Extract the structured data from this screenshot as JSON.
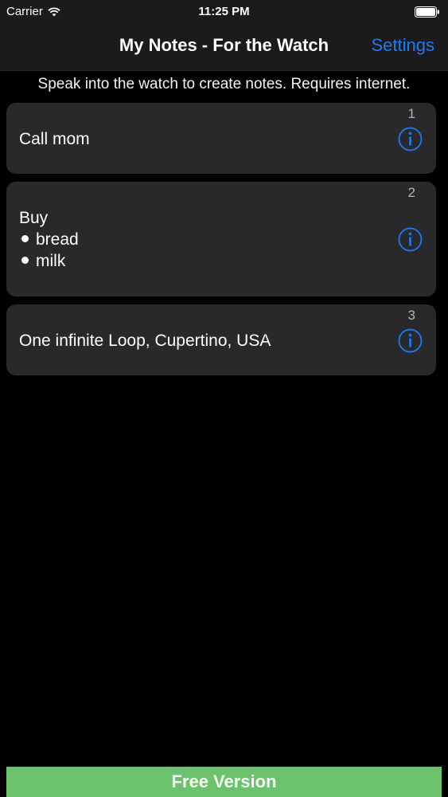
{
  "status_bar": {
    "carrier": "Carrier",
    "time": "11:25 PM"
  },
  "nav": {
    "title": "My Notes - For the Watch",
    "settings_label": "Settings"
  },
  "subtitle": "Speak into the watch to create notes. Requires internet.",
  "notes": [
    {
      "number": "1",
      "lines": [
        "Call mom"
      ]
    },
    {
      "number": "2",
      "lines": [
        "Buy"
      ],
      "bullets": [
        "bread",
        "milk"
      ]
    },
    {
      "number": "3",
      "lines": [
        "One infinite Loop, Cupertino, USA"
      ]
    }
  ],
  "footer": {
    "free_version_label": "Free Version"
  },
  "colors": {
    "accent": "#1a7cf5",
    "card": "#29292b",
    "free_bar": "#6cc16c"
  },
  "icons": {
    "wifi": "wifi-icon",
    "battery": "battery-icon",
    "info": "info-icon"
  }
}
